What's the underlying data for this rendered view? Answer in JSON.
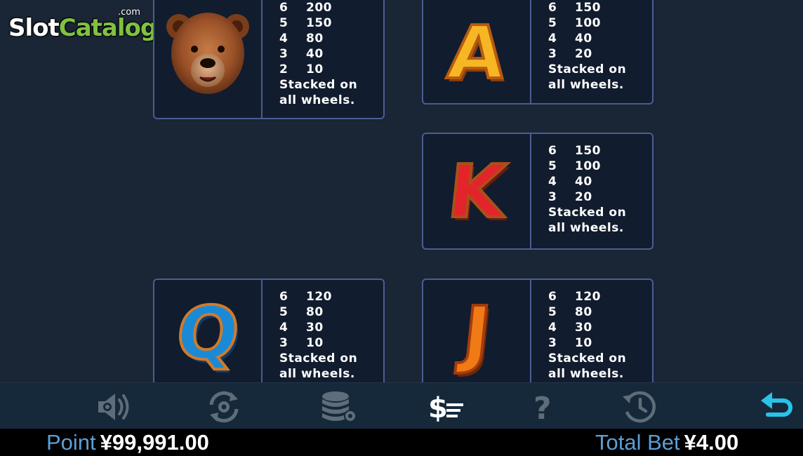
{
  "logo": {
    "slot": "Slot",
    "catalog": "Catalog",
    "dotcom": ".com"
  },
  "paytable": {
    "bear": {
      "icon": "bear-head-icon",
      "pays": [
        {
          "count": "6",
          "value": "200"
        },
        {
          "count": "5",
          "value": "150"
        },
        {
          "count": "4",
          "value": "80"
        },
        {
          "count": "3",
          "value": "40"
        },
        {
          "count": "2",
          "value": "10"
        }
      ],
      "note": "Stacked on all wheels."
    },
    "a": {
      "symbol": "A",
      "pays": [
        {
          "count": "6",
          "value": "150"
        },
        {
          "count": "5",
          "value": "100"
        },
        {
          "count": "4",
          "value": "40"
        },
        {
          "count": "3",
          "value": "20"
        }
      ],
      "note": "Stacked on all wheels."
    },
    "k": {
      "symbol": "K",
      "pays": [
        {
          "count": "6",
          "value": "150"
        },
        {
          "count": "5",
          "value": "100"
        },
        {
          "count": "4",
          "value": "40"
        },
        {
          "count": "3",
          "value": "20"
        }
      ],
      "note": "Stacked on all wheels."
    },
    "q": {
      "symbol": "Q",
      "pays": [
        {
          "count": "6",
          "value": "120"
        },
        {
          "count": "5",
          "value": "80"
        },
        {
          "count": "4",
          "value": "30"
        },
        {
          "count": "3",
          "value": "10"
        }
      ],
      "note": "Stacked on all wheels."
    },
    "j": {
      "symbol": "J",
      "pays": [
        {
          "count": "6",
          "value": "120"
        },
        {
          "count": "5",
          "value": "80"
        },
        {
          "count": "4",
          "value": "30"
        },
        {
          "count": "3",
          "value": "10"
        }
      ],
      "note": "Stacked on all wheels."
    }
  },
  "toolbar": {
    "icons": [
      "sound-settings-icon",
      "autoplay-settings-icon",
      "chips-settings-icon",
      "paytable-icon",
      "help-icon",
      "history-icon",
      "back-icon"
    ],
    "active": "paytable-icon",
    "colors": {
      "inactive": "#5f6d7a",
      "active": "#ffffff",
      "back": "#29c3e8"
    }
  },
  "status": {
    "point_label": "Point",
    "point_value": "¥99,991.00",
    "bet_label": "Total Bet",
    "bet_value": "¥4.00"
  }
}
